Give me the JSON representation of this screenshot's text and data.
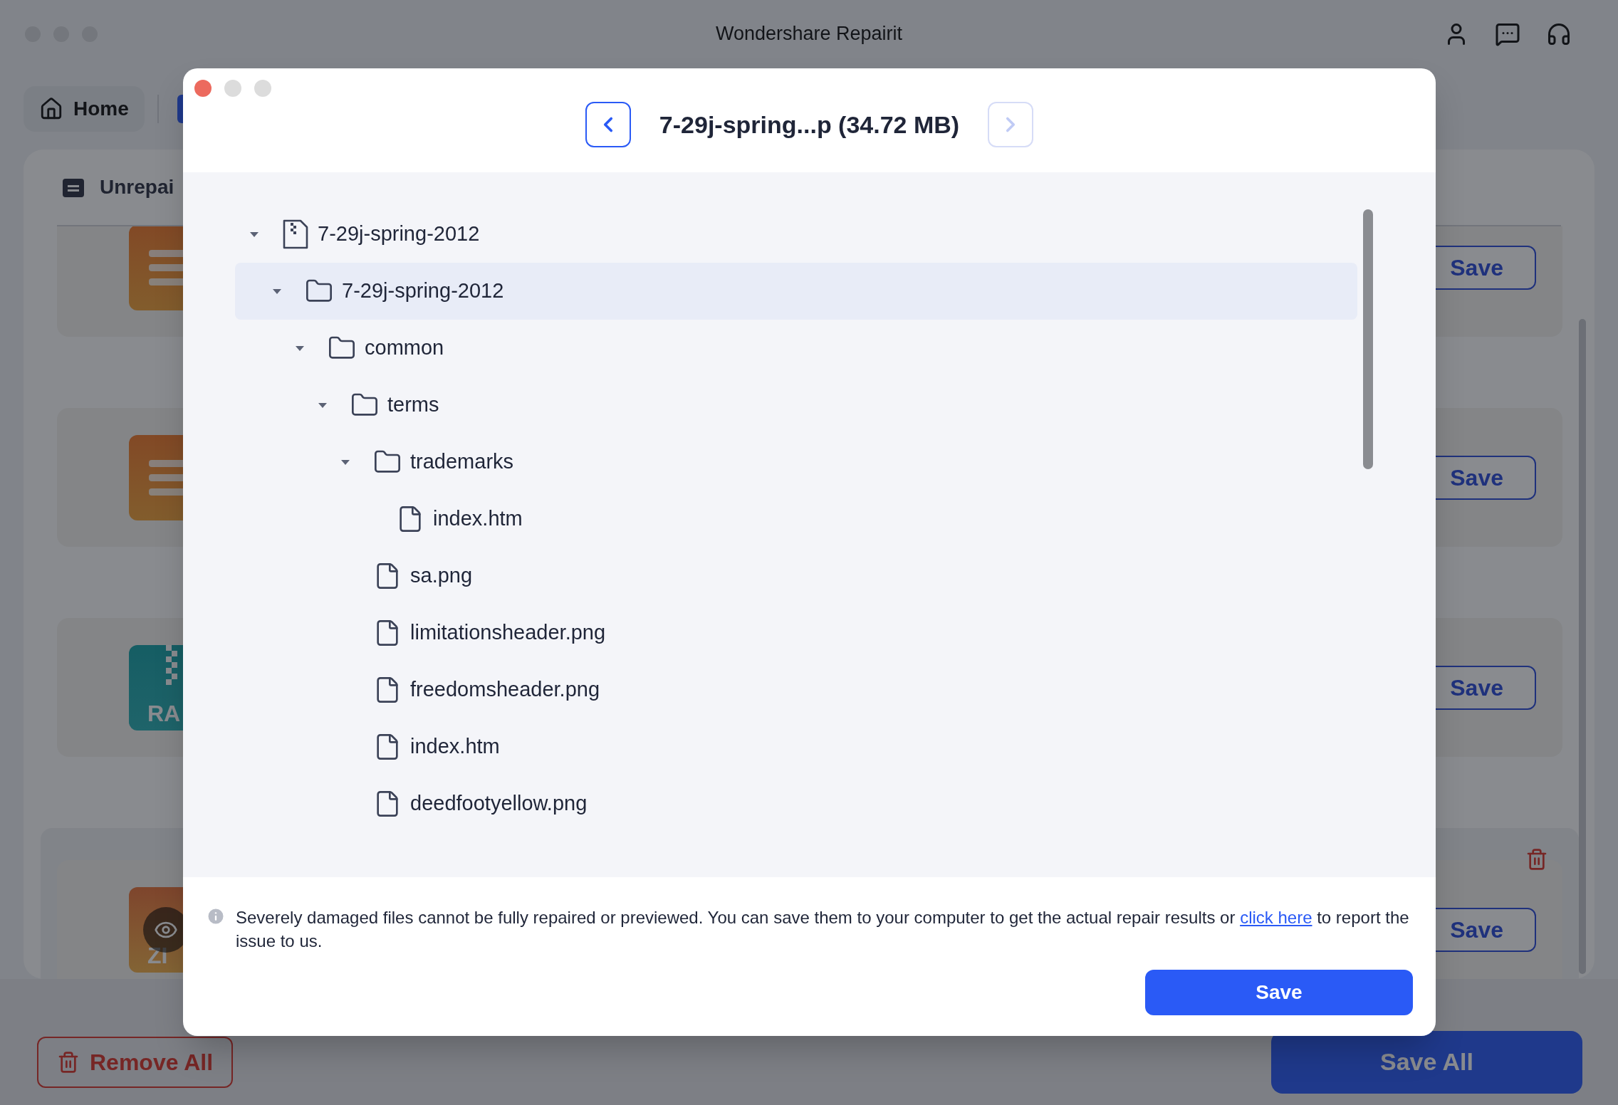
{
  "window": {
    "title": "Wondershare Repairit"
  },
  "toolbar": {
    "home_tab": "Home"
  },
  "panel": {
    "title": "Unrepai",
    "files": [
      {
        "kind": "doc",
        "save": "Save",
        "deletable": false
      },
      {
        "kind": "doc",
        "save": "Save",
        "deletable": false
      },
      {
        "kind": "rar",
        "thumb_label": "RA",
        "save": "Save",
        "deletable": false
      },
      {
        "kind": "zip",
        "thumb_label": "ZI",
        "save": "Save",
        "deletable": true
      }
    ]
  },
  "bottom_bar": {
    "remove_all": "Remove All",
    "save_all": "Save All"
  },
  "dialog": {
    "title": "7-29j-spring...p (34.72 MB)",
    "prev_enabled": true,
    "next_enabled": false,
    "tree": [
      {
        "name": "7-29j-spring-2012",
        "kind": "archive",
        "expanded": true,
        "selected": false,
        "children": [
          {
            "name": "7-29j-spring-2012",
            "kind": "folder",
            "expanded": true,
            "selected": true,
            "children": [
              {
                "name": "common",
                "kind": "folder",
                "expanded": true,
                "selected": false,
                "children": [
                  {
                    "name": "terms",
                    "kind": "folder",
                    "expanded": true,
                    "selected": false,
                    "children": [
                      {
                        "name": "trademarks",
                        "kind": "folder",
                        "expanded": true,
                        "selected": false,
                        "children": [
                          {
                            "name": "index.htm",
                            "kind": "file",
                            "selected": false
                          }
                        ]
                      },
                      {
                        "name": "sa.png",
                        "kind": "file",
                        "selected": false
                      },
                      {
                        "name": "limitationsheader.png",
                        "kind": "file",
                        "selected": false
                      },
                      {
                        "name": "freedomsheader.png",
                        "kind": "file",
                        "selected": false
                      },
                      {
                        "name": "index.htm",
                        "kind": "file",
                        "selected": false
                      },
                      {
                        "name": "deedfootyellow.png",
                        "kind": "file",
                        "selected": false
                      }
                    ]
                  }
                ]
              }
            ]
          }
        ]
      }
    ],
    "notice": {
      "text_before": "Severely damaged files cannot be fully repaired or previewed. You can save them to your computer to get the actual repair results or",
      "link": "click here",
      "text_after": "to report the issue to us."
    },
    "save_button": "Save"
  }
}
